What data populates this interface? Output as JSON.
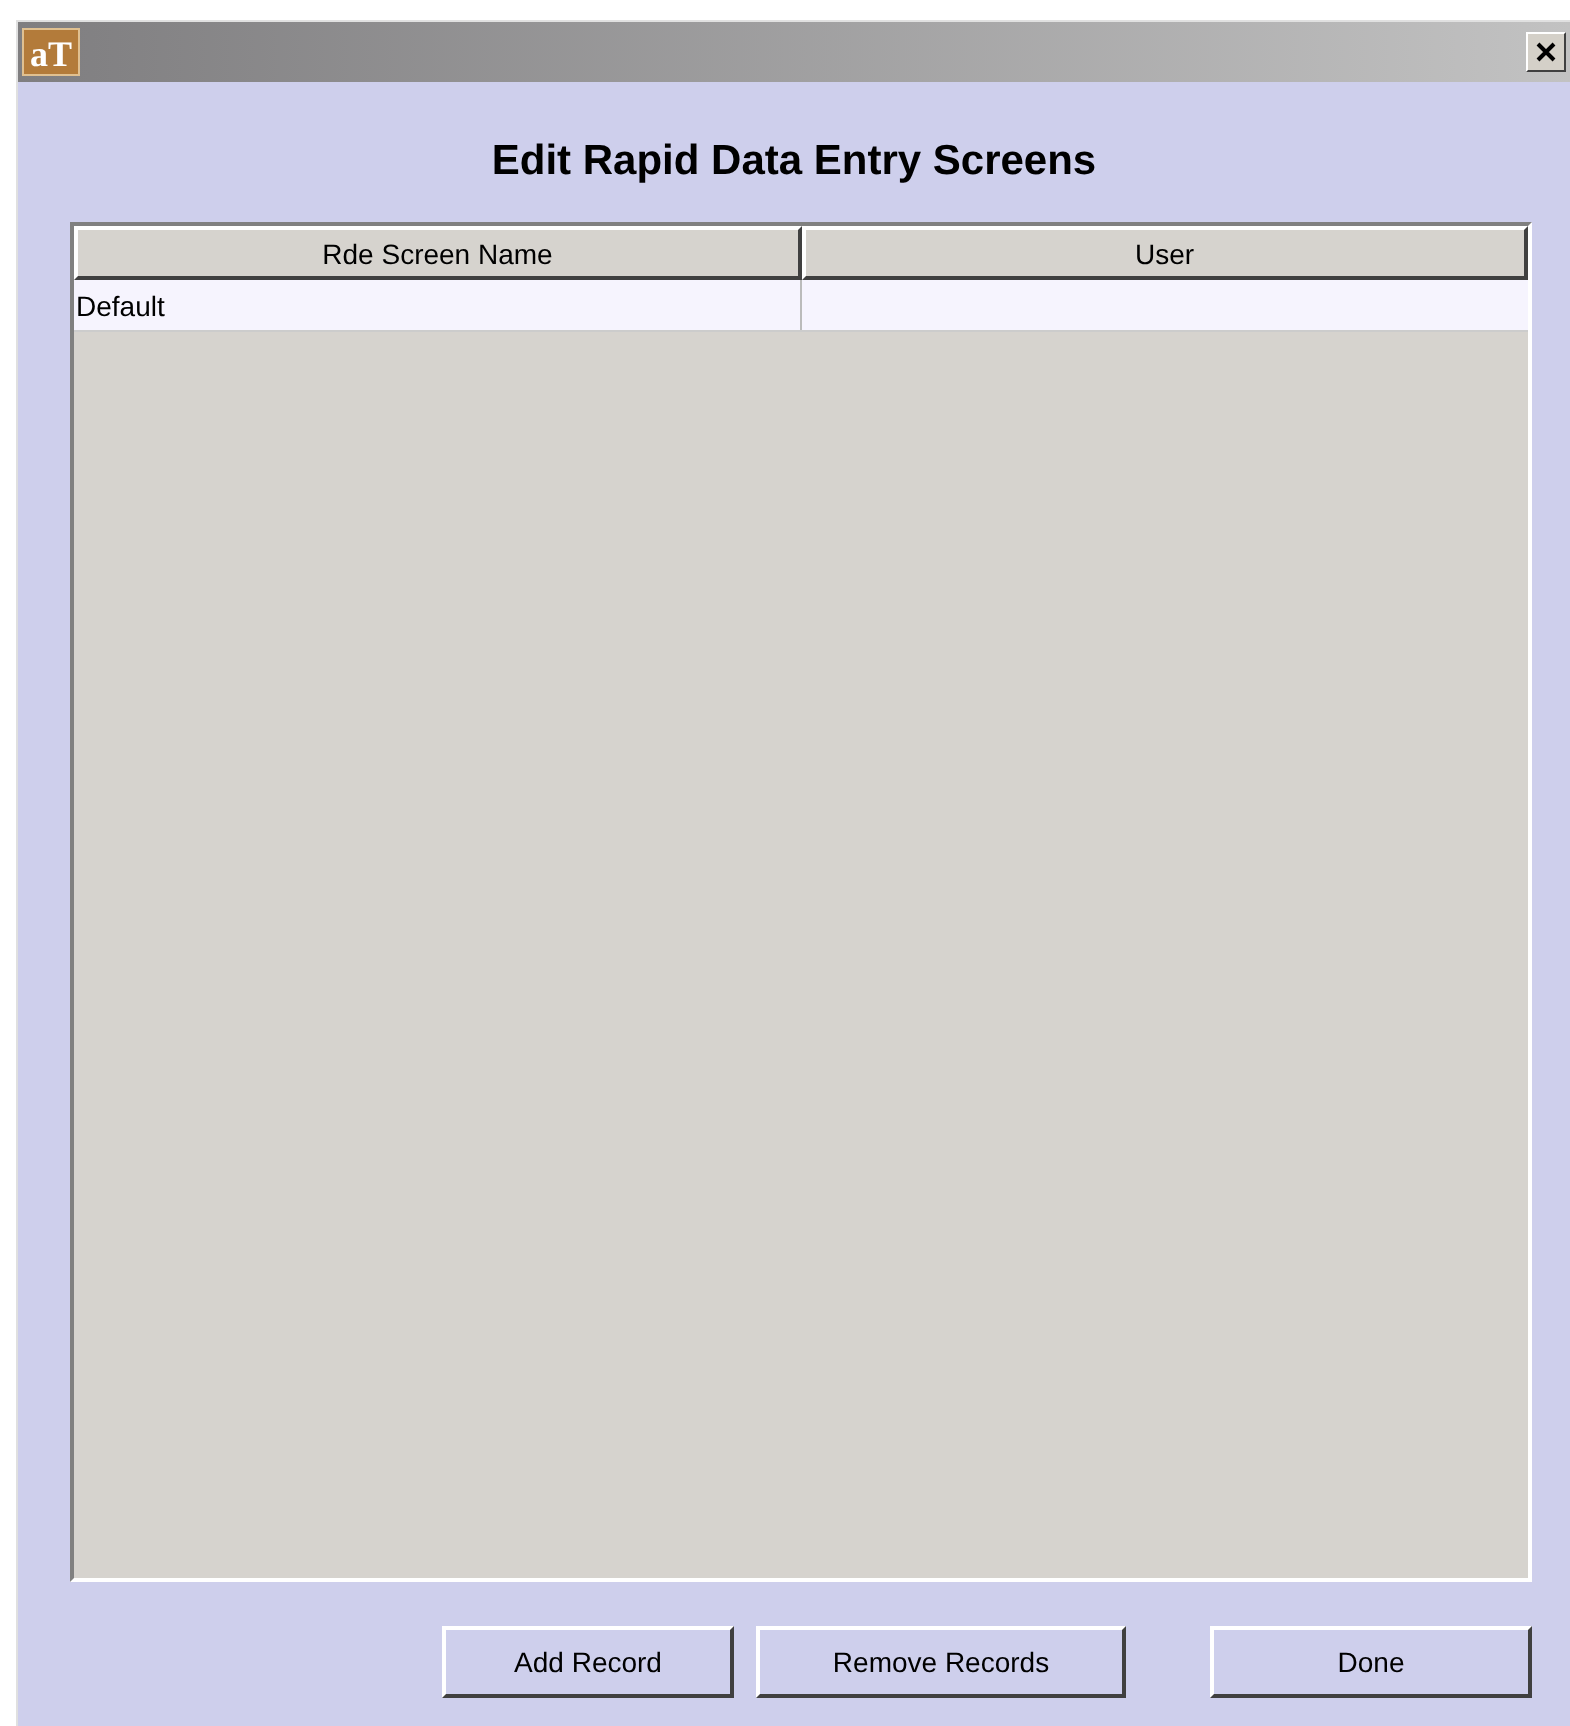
{
  "window": {
    "logo": "aT"
  },
  "title": "Edit Rapid Data Entry Screens",
  "table": {
    "columns": [
      "Rde Screen Name",
      "User"
    ],
    "rows": [
      [
        "Default",
        ""
      ]
    ]
  },
  "buttons": [
    "Add Record",
    "Remove Records",
    "Done"
  ]
}
